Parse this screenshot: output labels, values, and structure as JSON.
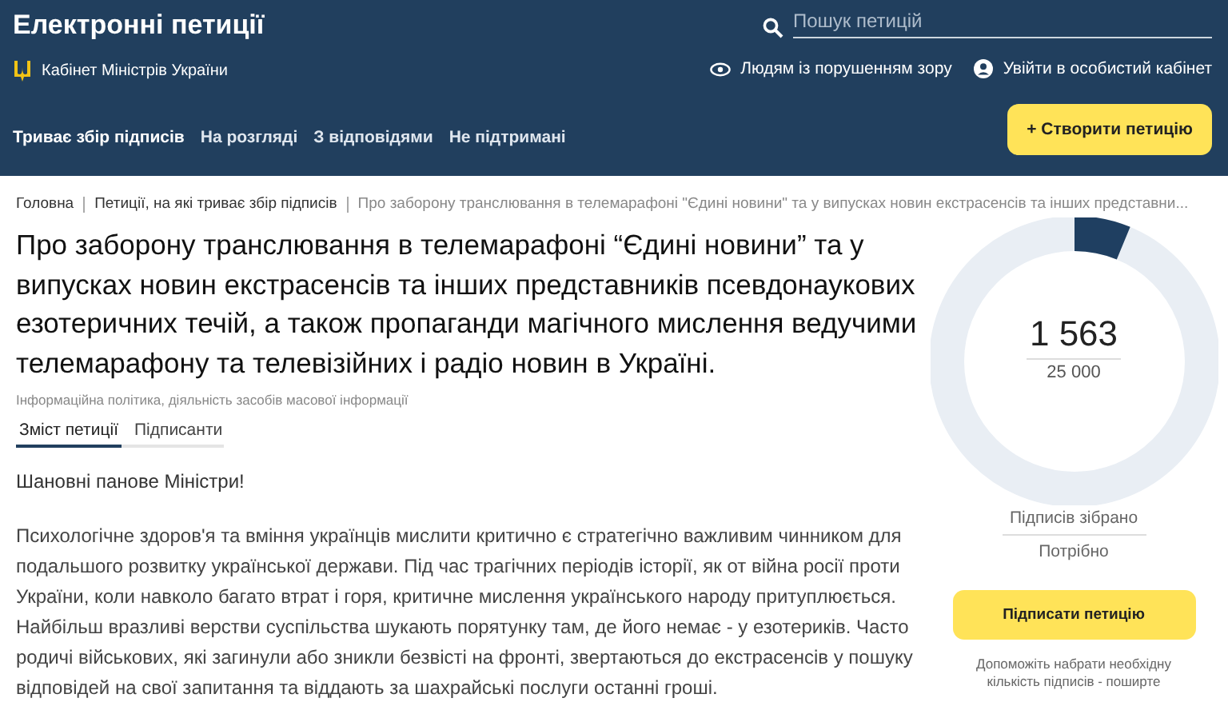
{
  "header": {
    "title": "Електронні петиції",
    "subtitle": "Кабінет Міністрів України",
    "search": {
      "placeholder": "Пошук петицій"
    },
    "accessibility_link": "Людям із порушенням зору",
    "login_link": "Увійти в особистий кабінет",
    "nav": [
      {
        "label": "Триває збір підписів",
        "selected": true
      },
      {
        "label": "На розгляді",
        "selected": false
      },
      {
        "label": "З відповідями",
        "selected": false
      },
      {
        "label": "Не підтримані",
        "selected": false
      }
    ],
    "create_button": "+ Створити петицію"
  },
  "breadcrumb": [
    "Головна",
    "Петиції, на які триває збір підписів",
    "Про заборону транслювання в телемарафоні \"Єдині новини\" та у випусках новин екстрасенсів та інших представни..."
  ],
  "petition": {
    "title": "Про заборону транслювання в телемарафоні “Єдині новини” та у випусках новин екстрасенсів та інших представників псевдонаукових езотеричних течій, а також пропаганди магічного мислення ведучими телемарафону та телевізійних і радіо новин в Україні.",
    "category": "Інформаційна політика, діяльність засобів масової інформації",
    "tabs": [
      {
        "label": "Зміст петиції",
        "selected": true
      },
      {
        "label": "Підписанти",
        "selected": false
      }
    ],
    "greeting": "Шановні панове Міністри!",
    "body": "Психологічне здоров'я та вміння українців мислити критично є стратегічно важливим чинником для подальшого розвитку української держави. Під час трагічних періодів історії, як от війна росії проти України, коли навколо багато втрат і горя, критичне мислення українського народу притуплюється. Найбільш вразливі верстви суспільства шукають порятунку там, де його немає - у езотериків. Часто родичі військових, які загинули або зникли безвісті на фронті, звертаються до екстрасенсів у пошуку відповідей на свої запитання та віддають за шахрайські послуги останні гроші."
  },
  "signatures": {
    "count": "1 563",
    "goal": "25 000",
    "collected_label": "Підписів зібрано",
    "needed_label": "Потрібно",
    "sign_button": "Підписати петицію",
    "help_text": "Допоможіть набрати необхідну кількість підписів - поширте"
  }
}
